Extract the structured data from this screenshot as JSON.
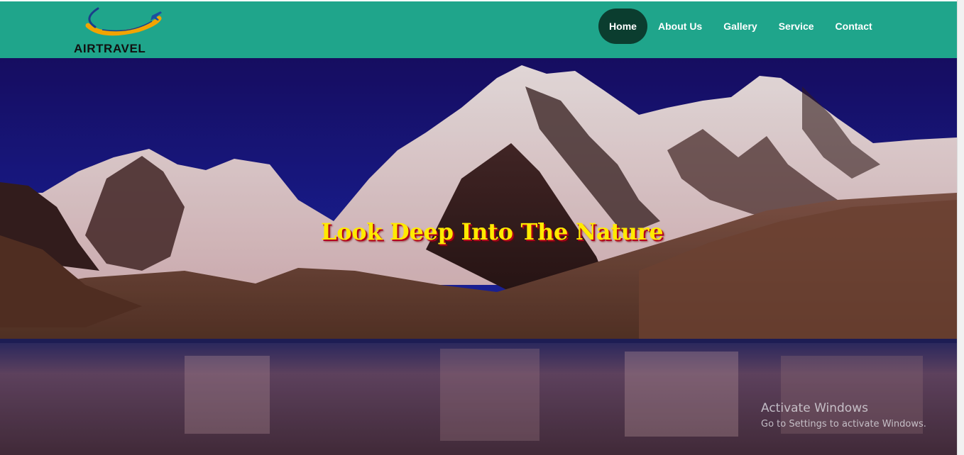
{
  "brand": {
    "name": "AIRTRAVEL"
  },
  "nav": {
    "items": [
      {
        "label": "Home",
        "active": true
      },
      {
        "label": "About Us",
        "active": false
      },
      {
        "label": "Gallery",
        "active": false
      },
      {
        "label": "Service",
        "active": false
      },
      {
        "label": "Contact",
        "active": false
      }
    ]
  },
  "hero": {
    "headline": "Look Deep Into The Nature"
  },
  "watermark": {
    "title": "Activate Windows",
    "subtitle": "Go to Settings to activate Windows."
  },
  "colors": {
    "navbar": "#1fa58b",
    "nav_active": "#0b3d2f",
    "headline": "#ffea00",
    "headline_shadow": "#b3001b"
  },
  "icons": {
    "logo": "plane-swoosh-logo-icon"
  }
}
